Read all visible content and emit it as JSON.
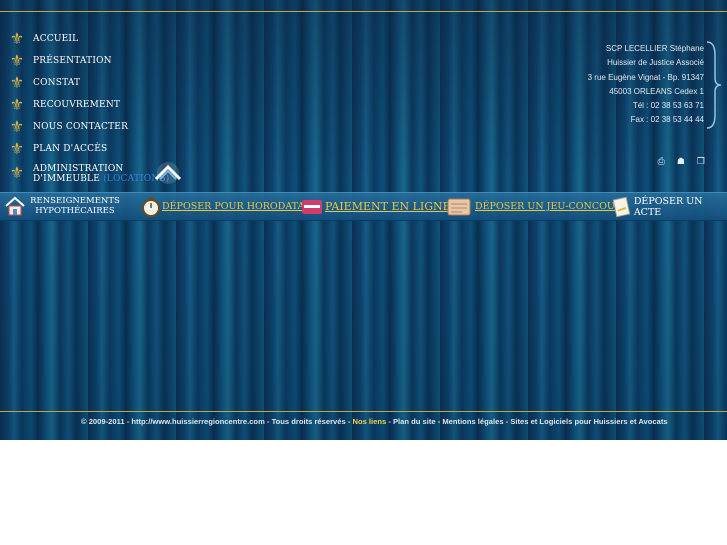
{
  "menu": {
    "items": [
      "ACCUEIL",
      "PRÉSENTATION",
      "CONSTAT",
      "RECOUVREMENT",
      "NOUS CONTACTER",
      "PLAN D'ACCÈS"
    ],
    "admin_line1": "ADMINISTRATION",
    "admin_line2": "D'IMMEUBLE",
    "admin_locations": "(LOCATIONS)"
  },
  "address": {
    "line1": "SCP LECELLIER Stéphane",
    "line2": "Huissier de Justice Associé",
    "line3": "3 rue Eugène Vignat - Bp. 91347",
    "line4": "45003 ORLEANS Cedex 1",
    "tel": "Tél : 02 38 53 63 71",
    "fax": "Fax : 02 38 53 44 44"
  },
  "tools": [
    "print-icon",
    "people-icon",
    "window-icon"
  ],
  "bar": {
    "renseignements_line1": "RENSEIGNEMENTS",
    "renseignements_line2": "HYPOTHÉCAIRES",
    "horodatage": "DÉPOSER POUR HORODATAGE",
    "paiement": "PAIEMENT EN LIGNE",
    "jeu": "DÉPOSER UN JEU-CONCOURS",
    "acte": "DÉPOSER UN ACTE"
  },
  "footer": {
    "copyright": "© 2009-2011 - http://www.huissierregioncentre.com - Tous droits réservés - ",
    "nos_liens": "Nos liens",
    "plan_site": " - Plan du site - ",
    "mentions": "Mentions légales",
    "sep": " - ",
    "sites": "Sites et Logiciels pour Huissiers et Avocats"
  },
  "colors": {
    "gold": "#c9a33c",
    "link_gold": "#e8c84a",
    "accent_blue": "#3a7fd0"
  }
}
